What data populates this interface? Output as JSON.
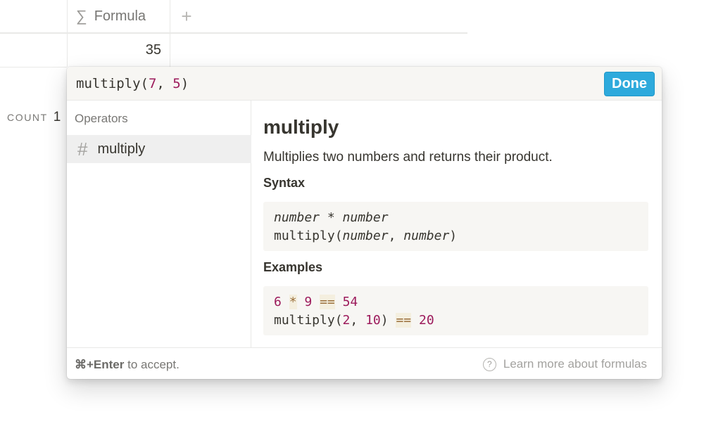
{
  "table": {
    "column_header": {
      "icon": "sigma-icon",
      "label": "Formula"
    },
    "add_column_label": "+",
    "cell_value": "35",
    "count": {
      "label": "COUNT",
      "value": "1"
    }
  },
  "popup": {
    "editor": {
      "tokens": {
        "fn": "multiply(",
        "a": "7",
        "sep": ", ",
        "b": "5",
        "close": ")"
      }
    },
    "done_label": "Done",
    "section_label": "Operators",
    "operator_item": {
      "icon": "hash-icon",
      "label": "multiply"
    },
    "doc": {
      "title": "multiply",
      "description": "Multiplies two numbers and returns their product.",
      "syntax_heading": "Syntax",
      "syntax": {
        "line1": {
          "a": "number",
          "op": " * ",
          "b": "number"
        },
        "line2": {
          "fn": "multiply(",
          "a": "number",
          "sep": ", ",
          "b": "number",
          "close": ")"
        }
      },
      "examples_heading": "Examples",
      "examples": {
        "line1": {
          "a": "6",
          "op": "*",
          "b": "9",
          "eq": "==",
          "res": "54"
        },
        "line2": {
          "fn": "multiply(",
          "a": "2",
          "sep": ", ",
          "b": "10",
          "close": ")",
          "eq": "==",
          "res": "20"
        }
      }
    },
    "footer": {
      "shortcut": "⌘+Enter",
      "hint_rest": " to accept.",
      "learn_icon": "help-circle-icon",
      "learn_label": "Learn more about formulas"
    }
  },
  "colors": {
    "accent": "#2eaadc",
    "number_token": "#9c1a5b",
    "operator_token": "#9a6e3a"
  }
}
